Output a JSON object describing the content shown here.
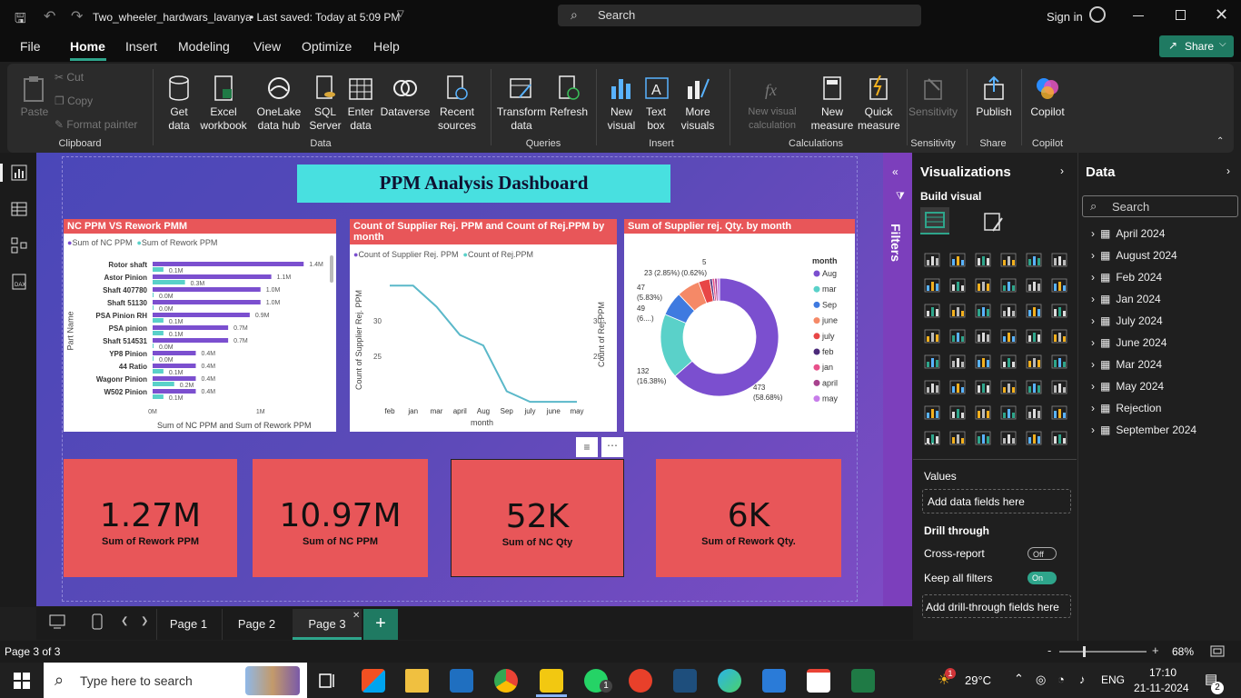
{
  "titlebar": {
    "file_name": "Two_wheeler_hardwars_lavanya",
    "saved": "• Last saved: Today at 5:09 PM",
    "search_placeholder": "Search",
    "signin": "Sign in"
  },
  "menu": [
    "File",
    "Home",
    "Insert",
    "Modeling",
    "View",
    "Optimize",
    "Help"
  ],
  "share_label": "Share",
  "ribbon": {
    "clipboard": {
      "paste": "Paste",
      "cut": "Cut",
      "copy": "Copy",
      "format_painter": "Format painter",
      "group": "Clipboard"
    },
    "data": {
      "get_data": "Get data",
      "excel": "Excel workbook",
      "onelake": "OneLake data hub",
      "sql": "SQL Server",
      "enter": "Enter data",
      "dataverse": "Dataverse",
      "recent": "Recent sources",
      "group": "Data"
    },
    "queries": {
      "transform": "Transform data",
      "refresh": "Refresh",
      "group": "Queries"
    },
    "insert": {
      "new_visual": "New visual",
      "text_box": "Text box",
      "more_visuals": "More visuals",
      "group": "Insert"
    },
    "calculations": {
      "new_visual_calc": "New visual calculation",
      "new_measure": "New measure",
      "quick_measure": "Quick measure",
      "group": "Calculations"
    },
    "sensitivity": {
      "label": "Sensitivity",
      "group": "Sensitivity"
    },
    "share": {
      "publish": "Publish",
      "group": "Share"
    },
    "copilot": {
      "label": "Copilot",
      "group": "Copilot"
    }
  },
  "report": {
    "title": "PPM Analysis Dashboard",
    "bar_chart": {
      "header": "NC PPM VS Rework PMM",
      "legend": [
        "Sum of NC PPM",
        "Sum of Rework PPM"
      ],
      "ylabel": "Part Name",
      "xlabel": "Sum of NC PPM and Sum of Rework PPM",
      "xticks": [
        "0M",
        "1M"
      ]
    },
    "line_chart": {
      "header": "Count of Supplier Rej. PPM and Count of Rej.PPM by month",
      "legend": [
        "Count of Supplier Rej. PPM",
        "Count of Rej.PPM"
      ],
      "ylabel_left": "Count of Supplier Rej. PPM",
      "ylabel_right": "Count of Rej.PPM",
      "xlabel": "month"
    },
    "donut_chart": {
      "header": "Sum of Supplier rej. Qty. by month",
      "legend_title": "month"
    },
    "kpis": [
      {
        "value": "1.27M",
        "label": "Sum of Rework PPM"
      },
      {
        "value": "10.97M",
        "label": "Sum of NC PPM"
      },
      {
        "value": "52K",
        "label": "Sum of NC Qty"
      },
      {
        "value": "6K",
        "label": "Sum of Rework Qty."
      }
    ]
  },
  "chart_data": [
    {
      "type": "bar",
      "categories": [
        "Rotor shaft",
        "Astor Pinion",
        "Shaft 407780",
        "Shaft 51130",
        "PSA Pinion RH",
        "PSA pinion",
        "Shaft 514531",
        "YP8 Pinion",
        "44 Ratio",
        "Wagonr Pinion",
        "W502 Pinion"
      ],
      "series": [
        {
          "name": "Sum of NC PPM",
          "values": [
            1.4,
            1.1,
            1.0,
            1.0,
            0.9,
            0.7,
            0.7,
            0.4,
            0.4,
            0.4,
            0.4
          ],
          "labels": [
            "1.4M",
            "1.1M",
            "1.0M",
            "1.0M",
            "0.9M",
            "0.7M",
            "0.7M",
            "0.4M",
            "0.4M",
            "0.4M",
            "0.4M"
          ]
        },
        {
          "name": "Sum of Rework PPM",
          "values": [
            0.1,
            0.3,
            0.0,
            0.0,
            0.1,
            0.1,
            0.0,
            0.0,
            0.1,
            0.2,
            0.1
          ],
          "labels": [
            "0.1M",
            "0.3M",
            "0.0M",
            "0.0M",
            "0.1M",
            "0.1M",
            "0.0M",
            "0.0M",
            "0.1M",
            "0.2M",
            "0.1M"
          ]
        }
      ],
      "xlim": [
        0,
        1.6
      ]
    },
    {
      "type": "line",
      "x": [
        "feb",
        "jan",
        "mar",
        "april",
        "Aug",
        "Sep",
        "july",
        "june",
        "may"
      ],
      "series": [
        {
          "name": "Count of Supplier Rej. PPM",
          "values": [
            35,
            35,
            32,
            28,
            26.5,
            20,
            18.5,
            18.5,
            18.5
          ]
        }
      ],
      "yticks_left": [
        25,
        30
      ],
      "yticks_right": [
        25,
        30
      ],
      "ylim": [
        18,
        38
      ]
    },
    {
      "type": "pie",
      "categories": [
        "Aug",
        "mar",
        "Sep",
        "june",
        "july",
        "feb",
        "jan",
        "april",
        "may"
      ],
      "values": [
        473,
        132,
        49,
        47,
        23,
        5,
        5,
        5,
        5
      ],
      "colors": [
        "#7b4fcf",
        "#5ad1c9",
        "#3f7ae0",
        "#f58967",
        "#e84646",
        "#4b2a7a",
        "#e8508a",
        "#a8428e",
        "#c77dea"
      ],
      "data_labels": [
        {
          "text": "473",
          "sub": "(58.68%)"
        },
        {
          "text": "132",
          "sub": "(16.38%)"
        },
        {
          "text": "49",
          "sub": "(6....)"
        },
        {
          "text": "47",
          "sub": "(5.83%)"
        },
        {
          "text": "23 (2.85%)",
          "sub": ""
        },
        {
          "text": "(0.62%)",
          "sub": ""
        },
        {
          "text": "5",
          "sub": ""
        }
      ]
    }
  ],
  "filters_label": "Filters",
  "visualizations": {
    "title": "Visualizations",
    "build_visual": "Build visual",
    "values": "Values",
    "add_data": "Add data fields here",
    "drill_through": "Drill through",
    "cross_report": "Cross-report",
    "cross_report_state": "Off",
    "keep_filters": "Keep all filters",
    "keep_filters_state": "On",
    "add_drill": "Add drill-through fields here",
    "more": "..."
  },
  "data_pane": {
    "title": "Data",
    "search_placeholder": "Search",
    "tables": [
      "April 2024",
      "August 2024",
      "Feb 2024",
      "Jan 2024",
      "July 2024",
      "June 2024",
      "Mar 2024",
      "May 2024",
      "Rejection",
      "September 2024"
    ]
  },
  "tabs": [
    "Page 1",
    "Page 2",
    "Page 3"
  ],
  "status": {
    "page": "Page 3 of 3",
    "zoom": "68%"
  },
  "taskbar": {
    "search": "Type here to search",
    "temp": "29°C",
    "lang": "ENG",
    "time": "17:10",
    "date": "21-11-2024",
    "weather_badge": "1",
    "whatsapp_badge": "1",
    "notif_badge": "2"
  }
}
